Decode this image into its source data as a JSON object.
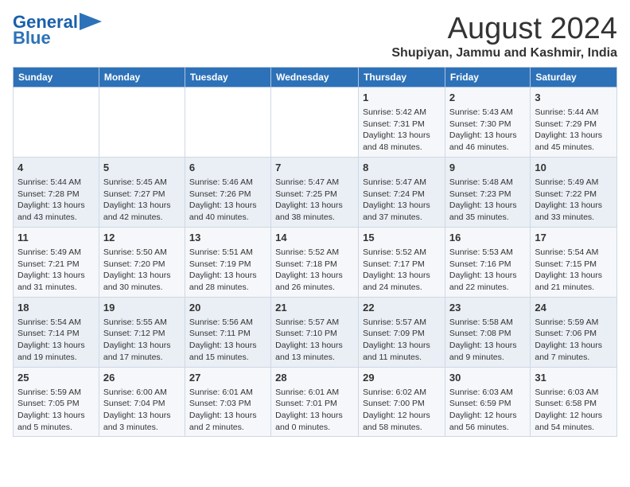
{
  "header": {
    "logo_line1": "General",
    "logo_line2": "Blue",
    "month_year": "August 2024",
    "location": "Shupiyan, Jammu and Kashmir, India"
  },
  "days_of_week": [
    "Sunday",
    "Monday",
    "Tuesday",
    "Wednesday",
    "Thursday",
    "Friday",
    "Saturday"
  ],
  "weeks": [
    [
      {
        "day": "",
        "info": ""
      },
      {
        "day": "",
        "info": ""
      },
      {
        "day": "",
        "info": ""
      },
      {
        "day": "",
        "info": ""
      },
      {
        "day": "1",
        "info": "Sunrise: 5:42 AM\nSunset: 7:31 PM\nDaylight: 13 hours and 48 minutes."
      },
      {
        "day": "2",
        "info": "Sunrise: 5:43 AM\nSunset: 7:30 PM\nDaylight: 13 hours and 46 minutes."
      },
      {
        "day": "3",
        "info": "Sunrise: 5:44 AM\nSunset: 7:29 PM\nDaylight: 13 hours and 45 minutes."
      }
    ],
    [
      {
        "day": "4",
        "info": "Sunrise: 5:44 AM\nSunset: 7:28 PM\nDaylight: 13 hours and 43 minutes."
      },
      {
        "day": "5",
        "info": "Sunrise: 5:45 AM\nSunset: 7:27 PM\nDaylight: 13 hours and 42 minutes."
      },
      {
        "day": "6",
        "info": "Sunrise: 5:46 AM\nSunset: 7:26 PM\nDaylight: 13 hours and 40 minutes."
      },
      {
        "day": "7",
        "info": "Sunrise: 5:47 AM\nSunset: 7:25 PM\nDaylight: 13 hours and 38 minutes."
      },
      {
        "day": "8",
        "info": "Sunrise: 5:47 AM\nSunset: 7:24 PM\nDaylight: 13 hours and 37 minutes."
      },
      {
        "day": "9",
        "info": "Sunrise: 5:48 AM\nSunset: 7:23 PM\nDaylight: 13 hours and 35 minutes."
      },
      {
        "day": "10",
        "info": "Sunrise: 5:49 AM\nSunset: 7:22 PM\nDaylight: 13 hours and 33 minutes."
      }
    ],
    [
      {
        "day": "11",
        "info": "Sunrise: 5:49 AM\nSunset: 7:21 PM\nDaylight: 13 hours and 31 minutes."
      },
      {
        "day": "12",
        "info": "Sunrise: 5:50 AM\nSunset: 7:20 PM\nDaylight: 13 hours and 30 minutes."
      },
      {
        "day": "13",
        "info": "Sunrise: 5:51 AM\nSunset: 7:19 PM\nDaylight: 13 hours and 28 minutes."
      },
      {
        "day": "14",
        "info": "Sunrise: 5:52 AM\nSunset: 7:18 PM\nDaylight: 13 hours and 26 minutes."
      },
      {
        "day": "15",
        "info": "Sunrise: 5:52 AM\nSunset: 7:17 PM\nDaylight: 13 hours and 24 minutes."
      },
      {
        "day": "16",
        "info": "Sunrise: 5:53 AM\nSunset: 7:16 PM\nDaylight: 13 hours and 22 minutes."
      },
      {
        "day": "17",
        "info": "Sunrise: 5:54 AM\nSunset: 7:15 PM\nDaylight: 13 hours and 21 minutes."
      }
    ],
    [
      {
        "day": "18",
        "info": "Sunrise: 5:54 AM\nSunset: 7:14 PM\nDaylight: 13 hours and 19 minutes."
      },
      {
        "day": "19",
        "info": "Sunrise: 5:55 AM\nSunset: 7:12 PM\nDaylight: 13 hours and 17 minutes."
      },
      {
        "day": "20",
        "info": "Sunrise: 5:56 AM\nSunset: 7:11 PM\nDaylight: 13 hours and 15 minutes."
      },
      {
        "day": "21",
        "info": "Sunrise: 5:57 AM\nSunset: 7:10 PM\nDaylight: 13 hours and 13 minutes."
      },
      {
        "day": "22",
        "info": "Sunrise: 5:57 AM\nSunset: 7:09 PM\nDaylight: 13 hours and 11 minutes."
      },
      {
        "day": "23",
        "info": "Sunrise: 5:58 AM\nSunset: 7:08 PM\nDaylight: 13 hours and 9 minutes."
      },
      {
        "day": "24",
        "info": "Sunrise: 5:59 AM\nSunset: 7:06 PM\nDaylight: 13 hours and 7 minutes."
      }
    ],
    [
      {
        "day": "25",
        "info": "Sunrise: 5:59 AM\nSunset: 7:05 PM\nDaylight: 13 hours and 5 minutes."
      },
      {
        "day": "26",
        "info": "Sunrise: 6:00 AM\nSunset: 7:04 PM\nDaylight: 13 hours and 3 minutes."
      },
      {
        "day": "27",
        "info": "Sunrise: 6:01 AM\nSunset: 7:03 PM\nDaylight: 13 hours and 2 minutes."
      },
      {
        "day": "28",
        "info": "Sunrise: 6:01 AM\nSunset: 7:01 PM\nDaylight: 13 hours and 0 minutes."
      },
      {
        "day": "29",
        "info": "Sunrise: 6:02 AM\nSunset: 7:00 PM\nDaylight: 12 hours and 58 minutes."
      },
      {
        "day": "30",
        "info": "Sunrise: 6:03 AM\nSunset: 6:59 PM\nDaylight: 12 hours and 56 minutes."
      },
      {
        "day": "31",
        "info": "Sunrise: 6:03 AM\nSunset: 6:58 PM\nDaylight: 12 hours and 54 minutes."
      }
    ]
  ]
}
